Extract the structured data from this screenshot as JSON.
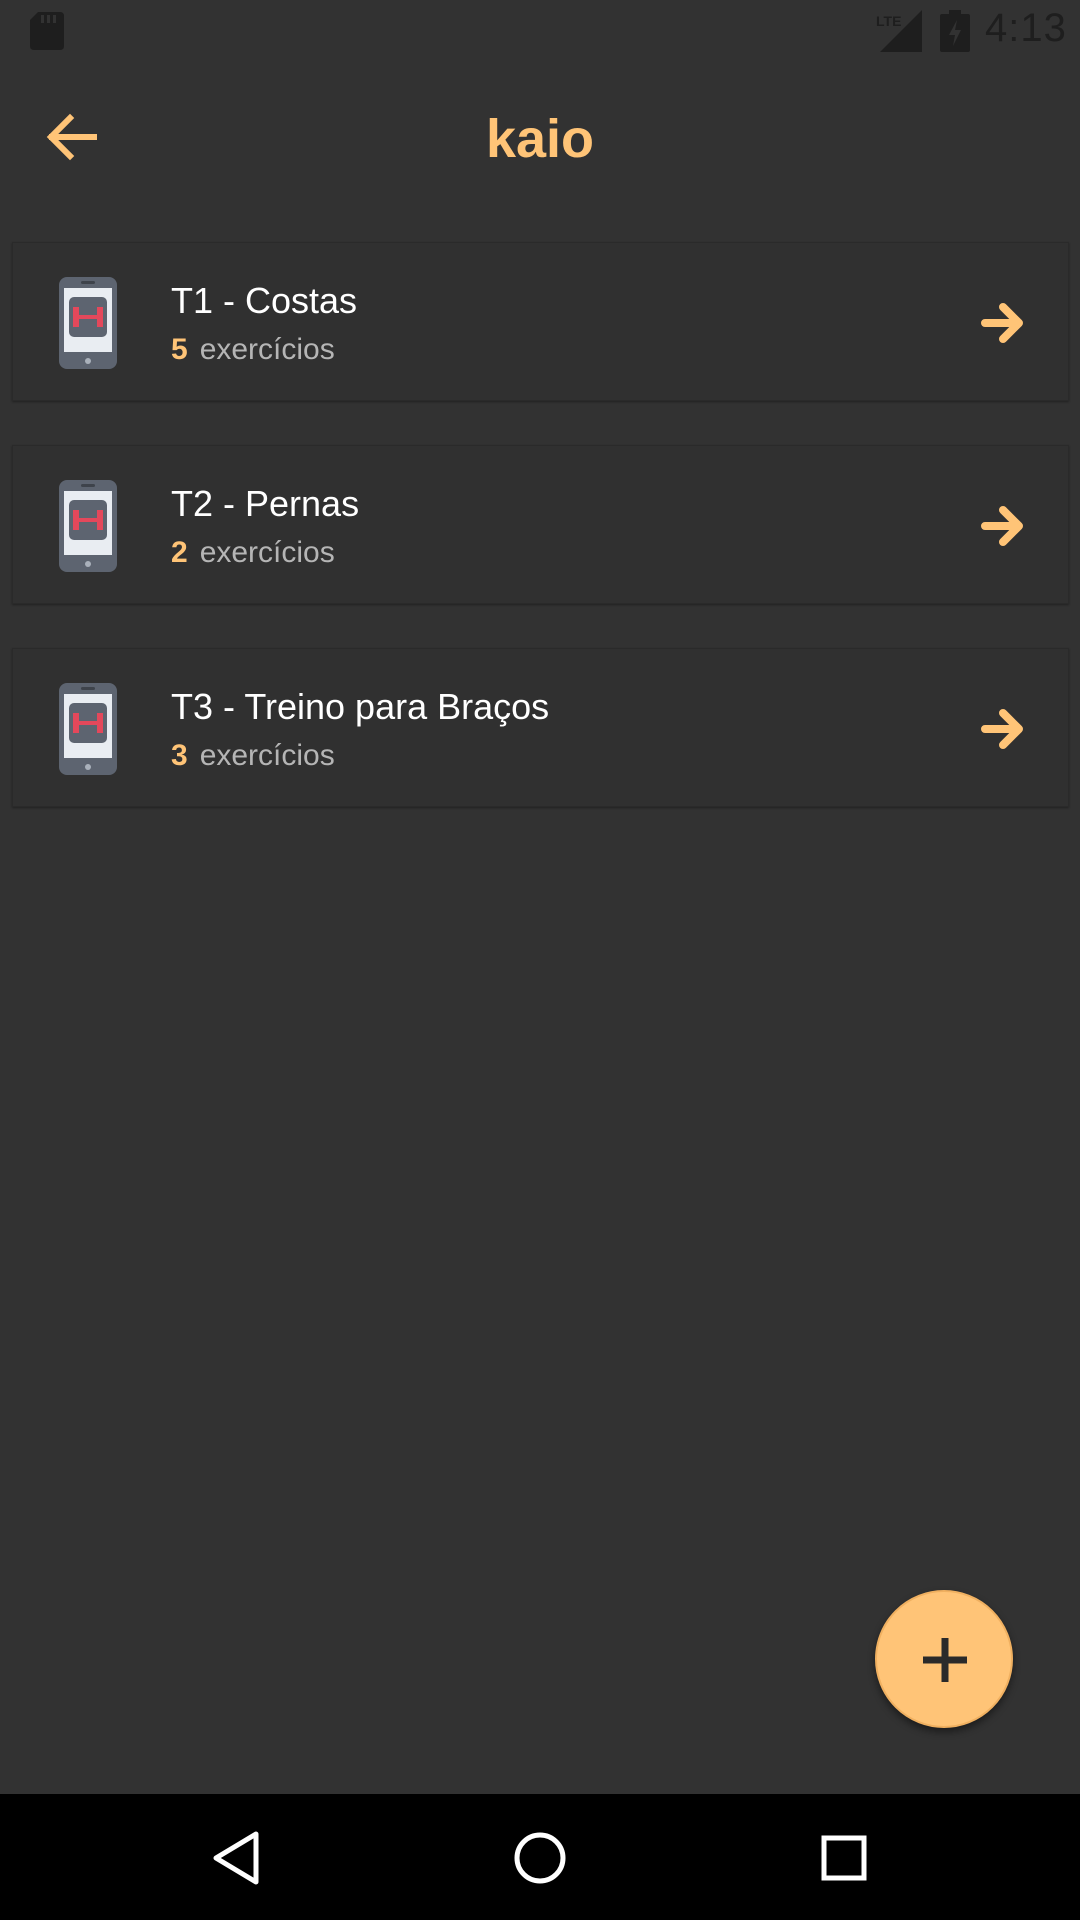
{
  "status_bar": {
    "time": "4:13",
    "network_label": "LTE",
    "icons": [
      "sd-card-icon",
      "signal-icon",
      "battery-charging-icon"
    ]
  },
  "app_bar": {
    "title": "kaio",
    "back_icon": "arrow-left-icon"
  },
  "colors": {
    "accent": "#FFC477",
    "background": "#323232",
    "card": "#303030",
    "secondary_text": "#b5b5b5",
    "nav_bar": "#000000"
  },
  "workouts": [
    {
      "title": "T1 - Costas",
      "count": "5",
      "count_label": "exercícios",
      "icon": "phone-dumbbell-icon",
      "action_icon": "arrow-right-icon"
    },
    {
      "title": "T2 - Pernas",
      "count": "2",
      "count_label": "exercícios",
      "icon": "phone-dumbbell-icon",
      "action_icon": "arrow-right-icon"
    },
    {
      "title": "T3 - Treino para Braços",
      "count": "3",
      "count_label": "exercícios",
      "icon": "phone-dumbbell-icon",
      "action_icon": "arrow-right-icon"
    }
  ],
  "fab": {
    "icon": "plus-icon"
  },
  "nav_bar": {
    "buttons": [
      "back-triangle-icon",
      "home-circle-icon",
      "recents-square-icon"
    ]
  }
}
